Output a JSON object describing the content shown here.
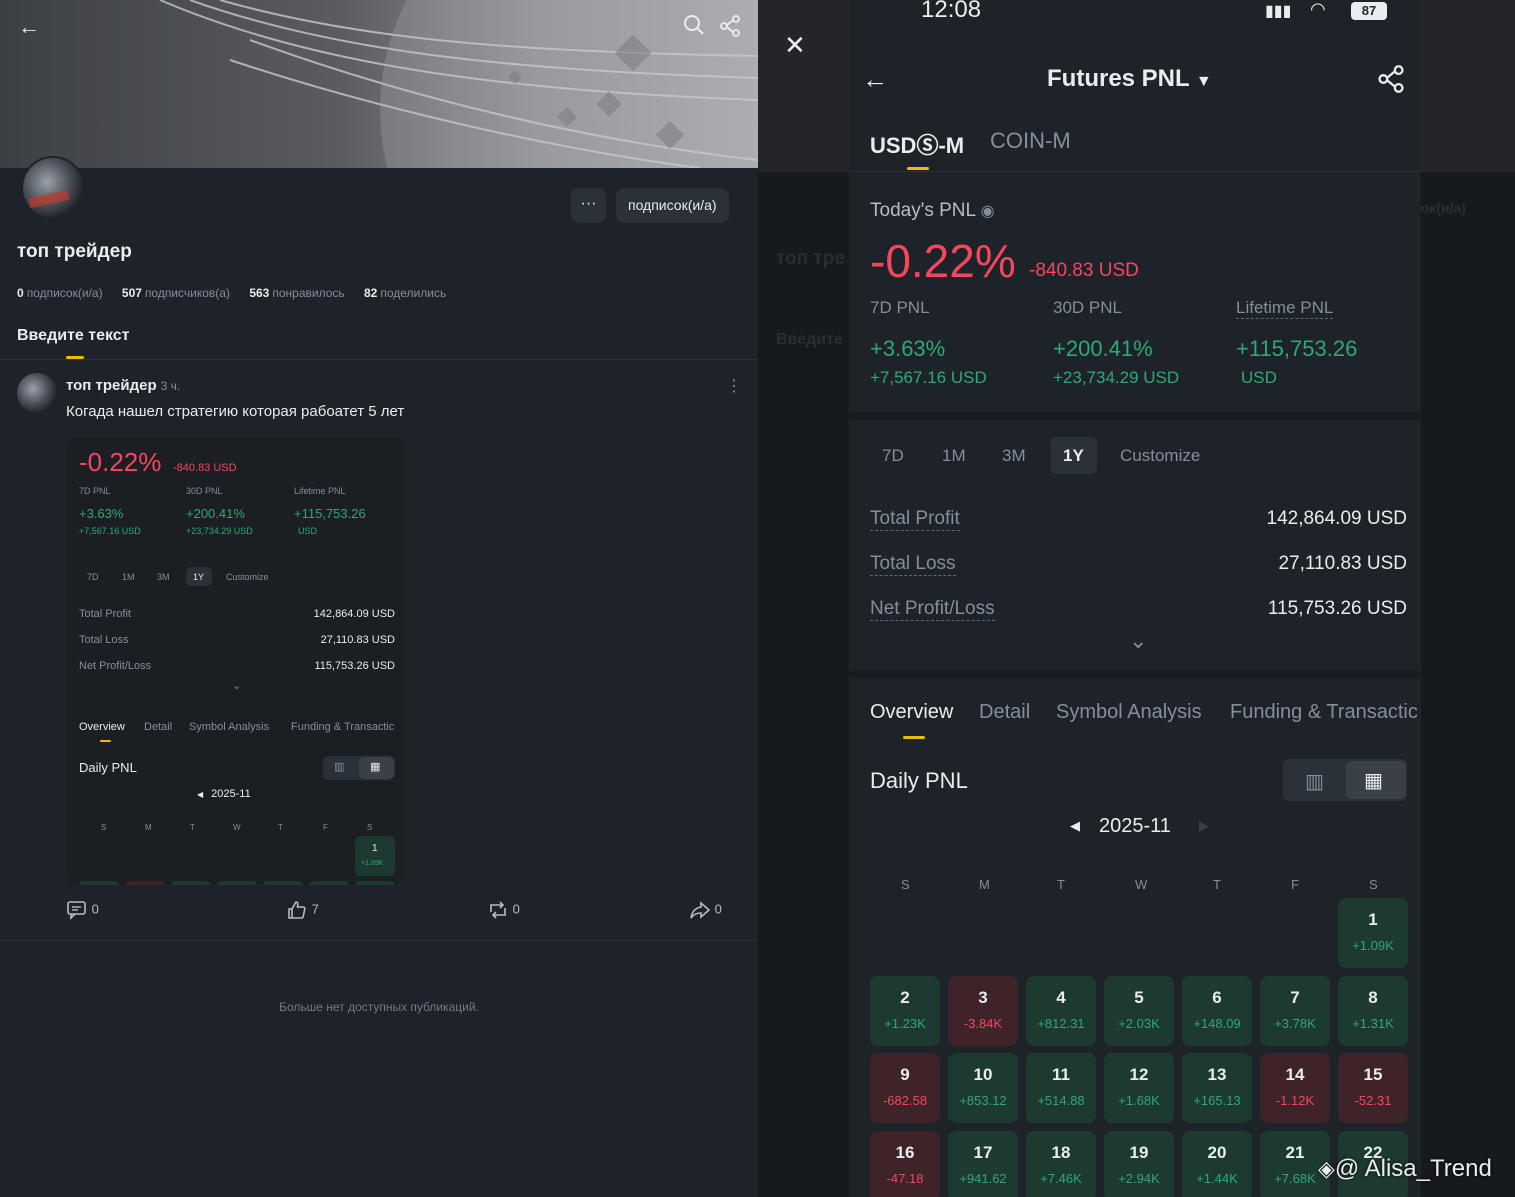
{
  "left": {
    "profile": {
      "more_label": "···",
      "subscribe_label": "подписок(и/а)",
      "name": "топ трейдер",
      "stats": [
        {
          "value": "0",
          "label": "подписок(и/а)"
        },
        {
          "value": "507",
          "label": "подписчиков(а)"
        },
        {
          "value": "563",
          "label": "понравилось"
        },
        {
          "value": "82",
          "label": "поделились"
        }
      ],
      "tab": "Введите текст"
    },
    "post": {
      "author": "топ трейдер",
      "time": "3 ч.",
      "text": "Когада нашел стратегию которая рабоатет 5 лет",
      "actions": {
        "comments": "0",
        "likes": "7",
        "reposts": "0",
        "shares": "0"
      }
    },
    "no_more": "Больше нет доступных публикаций."
  },
  "pnl": {
    "status_time": "12:08",
    "battery": "87",
    "title": "Futures PNL",
    "tabs": [
      "USDⓈ-M",
      "COIN-M"
    ],
    "today_label": "Today's PNL",
    "today_pct": "-0.22%",
    "today_usd": "-840.83 USD",
    "periods": [
      {
        "label": "7D PNL",
        "pct": "+3.63%",
        "usd": "+7,567.16 USD"
      },
      {
        "label": "30D PNL",
        "pct": "+200.41%",
        "usd": "+23,734.29 USD"
      },
      {
        "label": "Lifetime PNL",
        "pct": "+115,753.26",
        "usd": "USD"
      }
    ],
    "ranges": [
      "7D",
      "1M",
      "3M",
      "1Y",
      "Customize"
    ],
    "totals": [
      {
        "label": "Total Profit",
        "value": "142,864.09 USD"
      },
      {
        "label": "Total Loss",
        "value": "27,110.83 USD"
      },
      {
        "label": "Net Profit/Loss",
        "value": "115,753.26 USD"
      }
    ],
    "subtabs": [
      "Overview",
      "Detail",
      "Symbol Analysis",
      "Funding & Transactic"
    ],
    "daily_label": "Daily PNL",
    "month": "2025-11",
    "weekdays": [
      "S",
      "M",
      "T",
      "W",
      "T",
      "F",
      "S"
    ],
    "days": [
      {
        "d": "1",
        "v": "+1.09K",
        "s": "g"
      },
      {
        "d": "2",
        "v": "+1.23K",
        "s": "g"
      },
      {
        "d": "3",
        "v": "-3.84K",
        "s": "r"
      },
      {
        "d": "4",
        "v": "+812.31",
        "s": "g"
      },
      {
        "d": "5",
        "v": "+2.03K",
        "s": "g"
      },
      {
        "d": "6",
        "v": "+148.09",
        "s": "g"
      },
      {
        "d": "7",
        "v": "+3.78K",
        "s": "g"
      },
      {
        "d": "8",
        "v": "+1.31K",
        "s": "g"
      },
      {
        "d": "9",
        "v": "-682.58",
        "s": "r"
      },
      {
        "d": "10",
        "v": "+853.12",
        "s": "g"
      },
      {
        "d": "11",
        "v": "+514.88",
        "s": "g"
      },
      {
        "d": "12",
        "v": "+1.68K",
        "s": "g"
      },
      {
        "d": "13",
        "v": "+165.13",
        "s": "g"
      },
      {
        "d": "14",
        "v": "-1.12K",
        "s": "r"
      },
      {
        "d": "15",
        "v": "-52.31",
        "s": "r"
      },
      {
        "d": "16",
        "v": "-47.18",
        "s": "r"
      },
      {
        "d": "17",
        "v": "+941.62",
        "s": "g"
      },
      {
        "d": "18",
        "v": "+7.46K",
        "s": "g"
      },
      {
        "d": "19",
        "v": "+2.94K",
        "s": "g"
      },
      {
        "d": "20",
        "v": "+1.44K",
        "s": "g"
      },
      {
        "d": "21",
        "v": "+7.68K",
        "s": "g"
      },
      {
        "d": "22",
        "v": "",
        "s": "g"
      }
    ]
  },
  "watermark": "@ Alisa_Trend",
  "colors": {
    "red": "#f6465d",
    "green": "#0ecb81",
    "accent": "#f0b90b",
    "bg": "#1e2329"
  }
}
